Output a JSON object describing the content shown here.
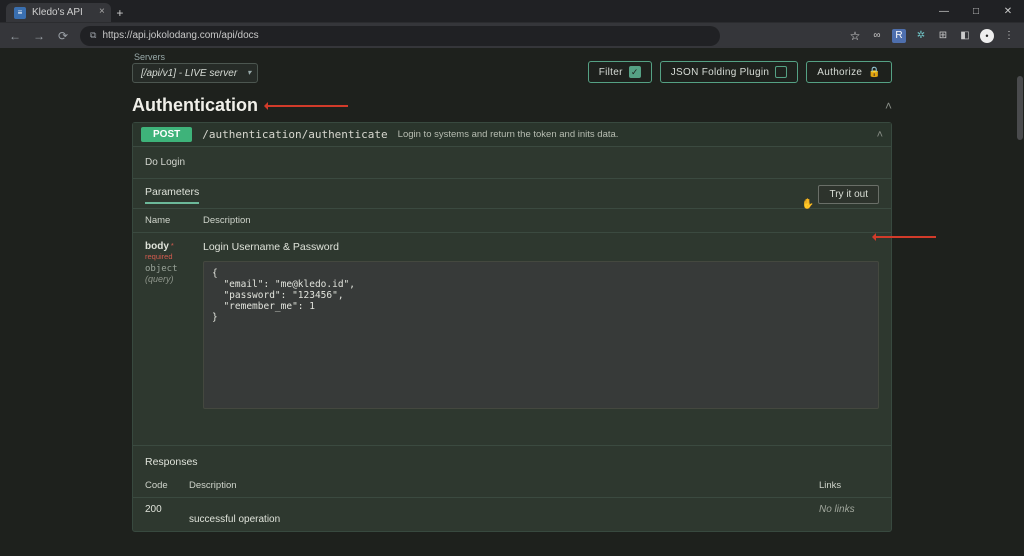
{
  "browser": {
    "tab_title": "Kledo's API",
    "url": "https://api.jokolodang.com/api/docs"
  },
  "toolbar": {
    "servers_label": "Servers",
    "server_value": "[/api/v1] - LIVE server",
    "filter_label": "Filter",
    "json_folding_label": "JSON Folding Plugin",
    "authorize_label": "Authorize"
  },
  "section": {
    "title": "Authentication"
  },
  "operation": {
    "method": "POST",
    "path": "/authentication/authenticate",
    "summary": "Login to systems and return the token and inits data.",
    "note": "Do Login",
    "parameters_tab": "Parameters",
    "try_label": "Try it out",
    "columns": {
      "name": "Name",
      "desc": "Description"
    },
    "param": {
      "name": "body",
      "required": "* required",
      "type": "object",
      "in": "(query)",
      "desc": "Login Username & Password",
      "example": "{\n  \"email\": \"me@kledo.id\",\n  \"password\": \"123456\",\n  \"remember_me\": 1\n}"
    },
    "responses": {
      "label": "Responses",
      "cols": {
        "code": "Code",
        "desc": "Description",
        "links": "Links"
      },
      "row": {
        "code": "200",
        "desc": "successful operation",
        "links": "No links"
      }
    }
  }
}
